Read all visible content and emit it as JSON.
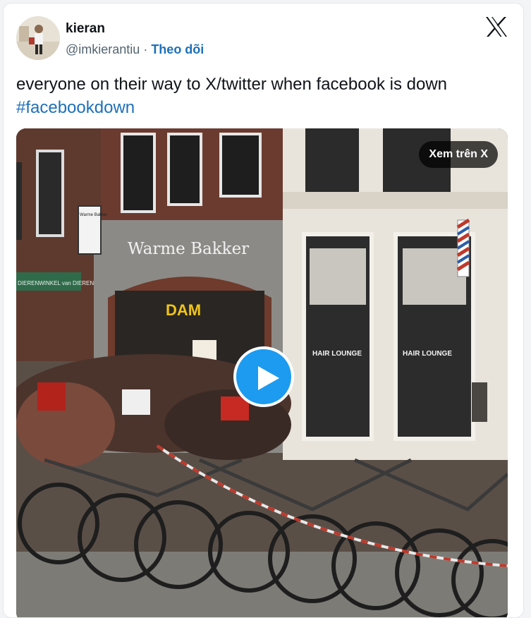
{
  "tweet": {
    "display_name": "kieran",
    "handle": "@imkierantiu",
    "separator": " · ",
    "follow_label": "Theo dõi",
    "text": "everyone on their way to X/twitter when facebook is down",
    "hashtag": "#facebookdown"
  },
  "media": {
    "view_on_x_label": "Xem trên X",
    "signs": {
      "bakery": "Warme Bakker",
      "dam": "DAM",
      "hair_left": "HAIR LOUNGE",
      "hair_right": "HAIR LOUNGE",
      "small_sign": "Warme Bakker",
      "green_banner": "DIERENWINKEL van DIEREN"
    }
  },
  "icons": {
    "logo": "x-logo-icon",
    "play": "play-icon"
  },
  "colors": {
    "link": "#1d70b8",
    "play_button": "#1d9bf0",
    "text": "#0f1419",
    "secondary": "#536471"
  }
}
